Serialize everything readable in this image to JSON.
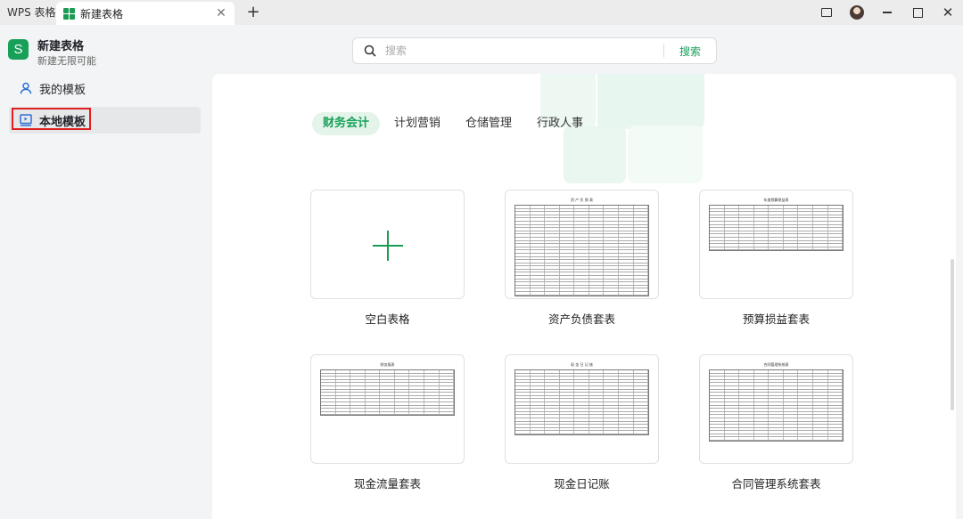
{
  "titlebar": {
    "home_tab": "WPS 表格",
    "active_tab": "新建表格",
    "new_tab_icon": "plus-icon",
    "right_icons": [
      "window-icon",
      "avatar",
      "minimize-icon",
      "maximize-icon",
      "close-icon"
    ]
  },
  "sidebar": {
    "brand_title": "新建表格",
    "brand_subtitle": "新建无限可能",
    "brand_logo_letter": "S",
    "items": [
      {
        "label": "我的模板",
        "icon": "user-icon",
        "active": false
      },
      {
        "label": "本地模板",
        "icon": "local-template-icon",
        "active": true
      }
    ]
  },
  "search": {
    "placeholder": "搜索",
    "button": "搜索"
  },
  "categories": [
    {
      "label": "财务会计",
      "active": true
    },
    {
      "label": "计划营销",
      "active": false
    },
    {
      "label": "仓储管理",
      "active": false
    },
    {
      "label": "行政人事",
      "active": false
    }
  ],
  "templates": [
    {
      "label": "空白表格",
      "thumb_title": ""
    },
    {
      "label": "资产负债套表",
      "thumb_title": "资 产 负 债 表"
    },
    {
      "label": "预算损益套表",
      "thumb_title": "年度预算损益表"
    },
    {
      "label": "现金流量套表",
      "thumb_title": "财务报表"
    },
    {
      "label": "现金日记账",
      "thumb_title": "现 金 日 记 账"
    },
    {
      "label": "合同管理系统套表",
      "thumb_title": "合同管理系统表"
    }
  ],
  "colors": {
    "accent": "#18a058",
    "highlight_border": "#e02020"
  }
}
